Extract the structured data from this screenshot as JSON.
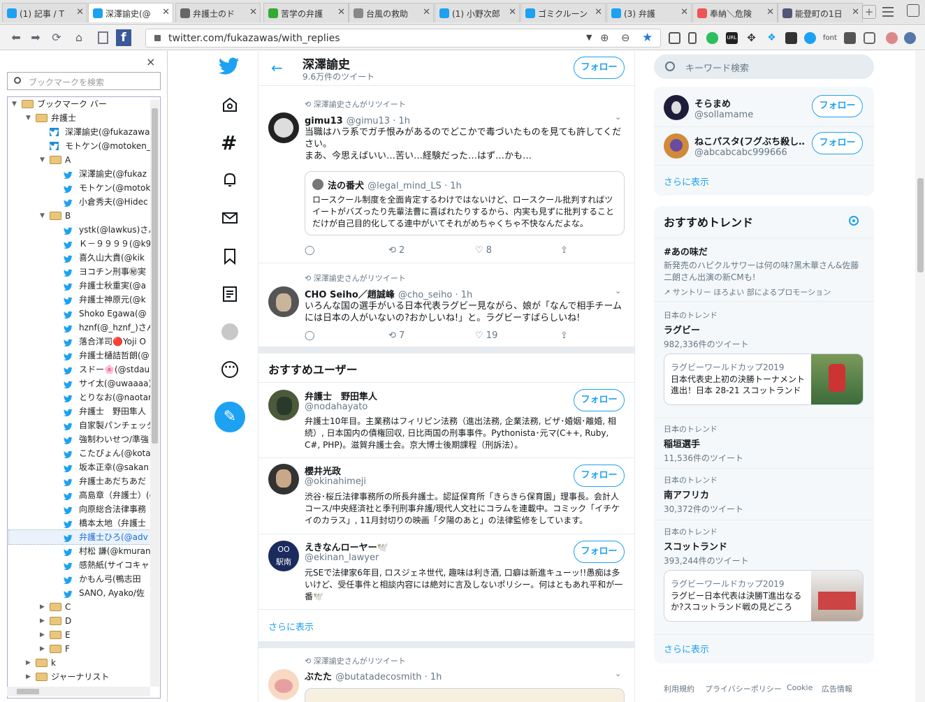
{
  "tabs": [
    {
      "label": "(1) 記事 / T",
      "color": "#1da1f2"
    },
    {
      "label": "深澤諭史(@",
      "color": "#1da1f2"
    },
    {
      "label": "弁護士のド",
      "color": "#666"
    },
    {
      "label": "苦学の弁護",
      "color": "#3a3"
    },
    {
      "label": "台風の救助",
      "color": "#888"
    },
    {
      "label": "(1) 小野次郎",
      "color": "#1da1f2"
    },
    {
      "label": "ゴミクルーン",
      "color": "#1da1f2"
    },
    {
      "label": "(3) 弁護",
      "color": "#1da1f2"
    },
    {
      "label": "奉納＼危険",
      "color": "#e55"
    },
    {
      "label": "能登町の1日",
      "color": "#557"
    }
  ],
  "url": "twitter.com/fukazawas/with_replies",
  "sidebar": {
    "search_placeholder": "ブックマークを検索",
    "close": "×",
    "items": [
      {
        "label": "ブックマーク バー",
        "type": "folder",
        "level": 0,
        "open": true
      },
      {
        "label": "弁護士",
        "type": "folder",
        "level": 1,
        "open": true
      },
      {
        "label": "深澤諭史(@fukazawa",
        "type": "tw",
        "level": 2
      },
      {
        "label": "モトケン(@motoken_",
        "type": "tw",
        "level": 2
      },
      {
        "label": "A",
        "type": "folder",
        "level": 2,
        "open": true
      },
      {
        "label": "深澤諭史(@fukaz",
        "type": "tw",
        "level": 3
      },
      {
        "label": "モトケン(@motok",
        "type": "tw",
        "level": 3
      },
      {
        "label": "小倉秀夫(@Hidec",
        "type": "tw",
        "level": 3
      },
      {
        "label": "B",
        "type": "folder",
        "level": 2,
        "open": true
      },
      {
        "label": "ystk(@lawkus)さん",
        "type": "tw",
        "level": 3
      },
      {
        "label": "Ｋ－９９９９(@k99",
        "type": "tw",
        "level": 3
      },
      {
        "label": "喜久山大貴(@kik",
        "type": "tw",
        "level": 3
      },
      {
        "label": "ヨコチン刑事㊙実",
        "type": "tw",
        "level": 3
      },
      {
        "label": "弁護士秋重実(@a",
        "type": "tw",
        "level": 3
      },
      {
        "label": "弁護士神原元(@k",
        "type": "tw",
        "level": 3
      },
      {
        "label": "Shoko Egawa(@",
        "type": "tw",
        "level": 3
      },
      {
        "label": "hznf(@_hznf_)さん",
        "type": "tw",
        "level": 3
      },
      {
        "label": "落合洋司🔴Yoji O",
        "type": "tw",
        "level": 3
      },
      {
        "label": "弁護士樋詰哲朗(@",
        "type": "tw",
        "level": 3
      },
      {
        "label": "スドー🌸(@stdau",
        "type": "tw",
        "level": 3
      },
      {
        "label": "サイ太(@uwaaaa)",
        "type": "tw",
        "level": 3
      },
      {
        "label": "とりなお(@naotar",
        "type": "tw",
        "level": 3
      },
      {
        "label": "弁護士　野田隼人",
        "type": "tw",
        "level": 3
      },
      {
        "label": "自家製パンチェッタ",
        "type": "tw",
        "level": 3
      },
      {
        "label": "強制わいせつ/準強",
        "type": "tw",
        "level": 3
      },
      {
        "label": "こたぴょん(@kotac",
        "type": "tw",
        "level": 3
      },
      {
        "label": "坂本正幸(@sakan",
        "type": "tw",
        "level": 3
      },
      {
        "label": "弁護士あだちあだ",
        "type": "tw",
        "level": 3
      },
      {
        "label": "高島章（弁護士）(@",
        "type": "tw",
        "level": 3
      },
      {
        "label": "向原総合法律事務",
        "type": "tw",
        "level": 3
      },
      {
        "label": "橋本太地（弁護士",
        "type": "tw",
        "level": 3
      },
      {
        "label": "弁護士ひろ(@adv",
        "type": "tw",
        "level": 3,
        "selected": true
      },
      {
        "label": "村松 謙(@kmuran",
        "type": "tw",
        "level": 3
      },
      {
        "label": "感熱紙(サイコキャ",
        "type": "tw",
        "level": 3
      },
      {
        "label": "かもん弓(鴨志田 ",
        "type": "tw",
        "level": 3
      },
      {
        "label": "SANO, Ayako/佐",
        "type": "tw",
        "level": 3
      },
      {
        "label": "C",
        "type": "folder",
        "level": 2,
        "open": false
      },
      {
        "label": "D",
        "type": "folder",
        "level": 2,
        "open": false
      },
      {
        "label": "E",
        "type": "folder",
        "level": 2,
        "open": false
      },
      {
        "label": "F",
        "type": "folder",
        "level": 2,
        "open": false
      },
      {
        "label": "k",
        "type": "folder",
        "level": 1,
        "open": false
      },
      {
        "label": "ジャーナリスト",
        "type": "folder",
        "level": 1,
        "open": false
      }
    ]
  },
  "header": {
    "name": "深澤諭史",
    "count": "9.6万件のツイート",
    "follow": "フォロー"
  },
  "tweets": [
    {
      "rt": "深澤諭史さんがリツイート",
      "name": "gimu13",
      "handle": "@gimu13 · 1h",
      "text": "当職はハラ系でガチ恨みがあるのでどこかで毒づいたものを見ても許してください。",
      "text2": "まあ、今思えばいい…苦い…経験だった…はず…かも…",
      "quote_name": "法の番犬",
      "quote_handle": "@legal_mind_LS · 1h",
      "quote_text": "ロースクール制度を全面肯定するわけではないけど、ロースクール批判すればツイートがバズったり先輩法曹に喜ばれたりするから、内実も見ずに批判することだけが自己目的化してる連中がいてそれがめちゃくちゃ不快なんだよな。",
      "retweets": "2",
      "likes": "8"
    },
    {
      "rt": "深澤諭史さんがリツイート",
      "name": "CHO Seiho／趙誠峰",
      "handle": "@cho_seiho · 1h",
      "text": "いろんな国の選手がいる日本代表ラグビー見ながら、娘が「なんで相手チームには日本の人がいないの?おかしいね!」と。ラグビーすばらしいね!",
      "retweets": "7",
      "likes": "19"
    }
  ],
  "who_to_follow": {
    "title": "おすすめユーザー",
    "more": "さらに表示",
    "users": [
      {
        "name": "弁護士　野田隼人",
        "handle": "@nodahayato",
        "bio": "弁護士10年目。主業務はフィリピン法務（進出法務, 企業法務, ビザ･婚姻･離婚, 相続）, 日本国内の債権回収, 日比両国の刑事事件。Pythonista･元マ(C++, Ruby, C#, PHP)。滋賀弁護士会。京大博士後期課程（刑訴法）。",
        "follow": "フォロー"
      },
      {
        "name": "櫻井光政",
        "handle": "@okinahimeji",
        "bio": "渋谷･桜丘法律事務所の所長弁護士。認証保育所「きらきら保育園」理事長。会計人コース/中央経済社と季刊刑事弁護/現代人文社にコラムを連載中。コミック「イチケイのカラス」, 11月封切りの映画「夕陽のあと」の法律監修をしています。",
        "follow": "フォロー"
      },
      {
        "name": "えきなんローヤー🕊️",
        "handle": "@ekinan_lawyer",
        "bio": "元SEで法律家6年目, ロスジェネ世代, 趣味は利き酒, 口癖は新進キューッ!!愚痴は多いけど、受任事件と相談内容には絶対に言及しないポリシー。何はともあれ平和が一番🕊️",
        "follow": "フォロー"
      }
    ]
  },
  "bottom_tweet": {
    "rt": "深澤諭史さんがリツイート",
    "name": "ぶたた",
    "handle": "@butatadecosmith · 1h"
  },
  "right": {
    "search_placeholder": "キーワード検索",
    "users": [
      {
        "name": "そらまめ",
        "handle": "@sollamame",
        "follow": "フォロー"
      },
      {
        "name": "ねこパスタ(フグぶち殺し…",
        "handle": "@abcabcabc999666",
        "follow": "フォロー"
      }
    ],
    "more": "さらに表示",
    "trends_title": "おすすめトレンド",
    "promo_trend": {
      "tag": "#あの味だ",
      "desc": "新発売のハピクルサワーは何の味?黒木華さん&佐藤二朗さん出演の新CMも!",
      "by": "サントリー ほろよい 部によるプロモーション"
    },
    "trends": [
      {
        "ctx": "日本のトレンド",
        "name": "ラグビー",
        "count": "982,336件のツイート"
      },
      {
        "ctx": "日本のトレンド",
        "name": "稲垣選手",
        "count": "11,536件のツイート"
      },
      {
        "ctx": "日本のトレンド",
        "name": "南アフリカ",
        "count": "30,372件のツイート"
      },
      {
        "ctx": "日本のトレンド",
        "name": "スコットランド",
        "count": "393,244件のツイート"
      }
    ],
    "promo1": {
      "t1": "ラグビーワールドカップ2019",
      "t2": "日本代表史上初の決勝トーナメント進出！日本 28-21 スコットランド"
    },
    "promo2": {
      "t1": "ラグビーワールドカップ2019",
      "t2": "ラグビー日本代表は決勝T進出なるか?スコットランド戦の見どころ"
    },
    "more2": "さらに表示",
    "footer": [
      "利用規約",
      "プライバシーポリシー",
      "Cookie",
      "広告情報"
    ]
  }
}
